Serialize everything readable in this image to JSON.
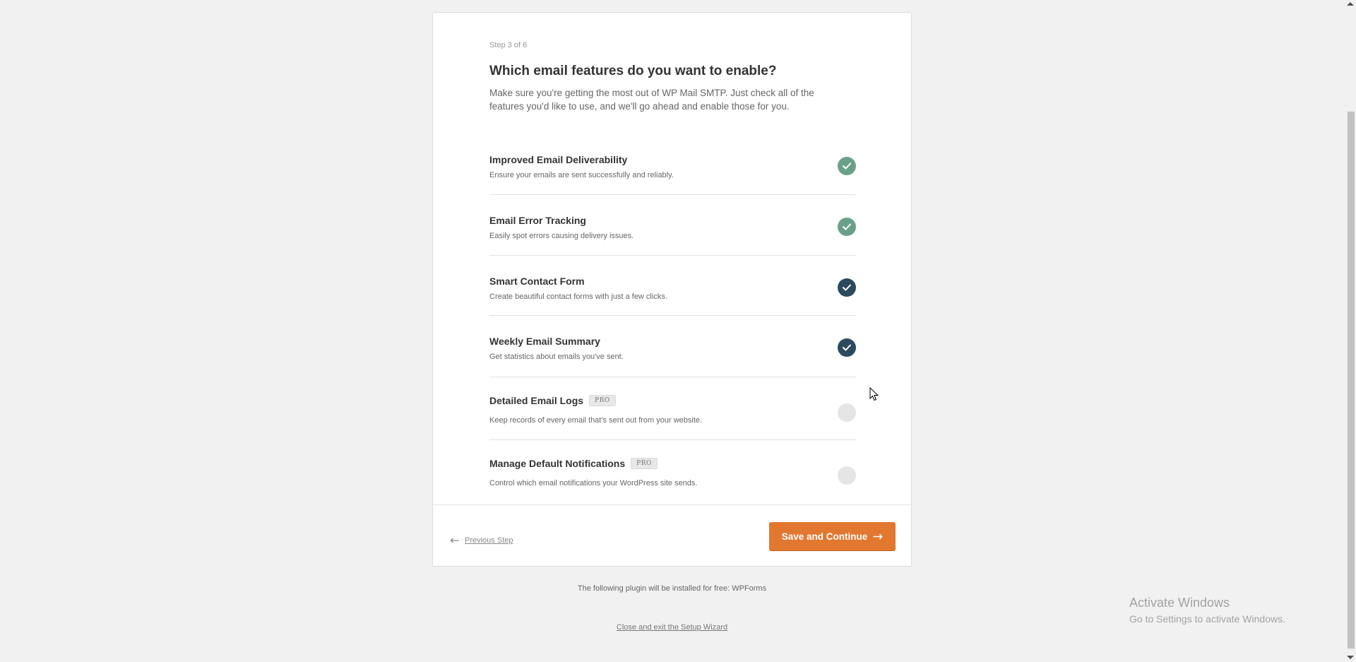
{
  "wizard": {
    "step": "Step 3 of 6",
    "title": "Which email features do you want to enable?",
    "description": "Make sure you're getting the most out of WP Mail SMTP. Just check all of the features you'd like to use, and we'll go ahead and enable those for you."
  },
  "features": [
    {
      "title": "Improved Email Deliverability",
      "description": "Ensure your emails are sent successfully and reliably.",
      "checked": true,
      "style": "green"
    },
    {
      "title": "Email Error Tracking",
      "description": "Easily spot errors causing delivery issues.",
      "checked": true,
      "style": "green"
    },
    {
      "title": "Smart Contact Form",
      "description": "Create beautiful contact forms with just a few clicks.",
      "checked": true,
      "style": "dark"
    },
    {
      "title": "Weekly Email Summary",
      "description": "Get statistics about emails you've sent.",
      "checked": true,
      "style": "dark"
    },
    {
      "title": "Detailed Email Logs",
      "badge": "PRO",
      "description": "Keep records of every email that's sent out from your website.",
      "checked": false
    },
    {
      "title": "Manage Default Notifications",
      "badge": "PRO",
      "description": "Control which email notifications your WordPress site sends.",
      "checked": false
    }
  ],
  "footer": {
    "previous_label": "Previous Step",
    "save_label": "Save and Continue"
  },
  "plugin_note": "The following plugin will be installed for free: WPForms",
  "close_link": "Close and exit the Setup Wizard",
  "watermark": {
    "line1": "Activate Windows",
    "line2": "Go to Settings to activate Windows."
  },
  "colors": {
    "accent": "#e27730",
    "check_green": "#6aa08a",
    "check_dark": "#2c4a5e",
    "check_off": "#e5e5e5"
  }
}
